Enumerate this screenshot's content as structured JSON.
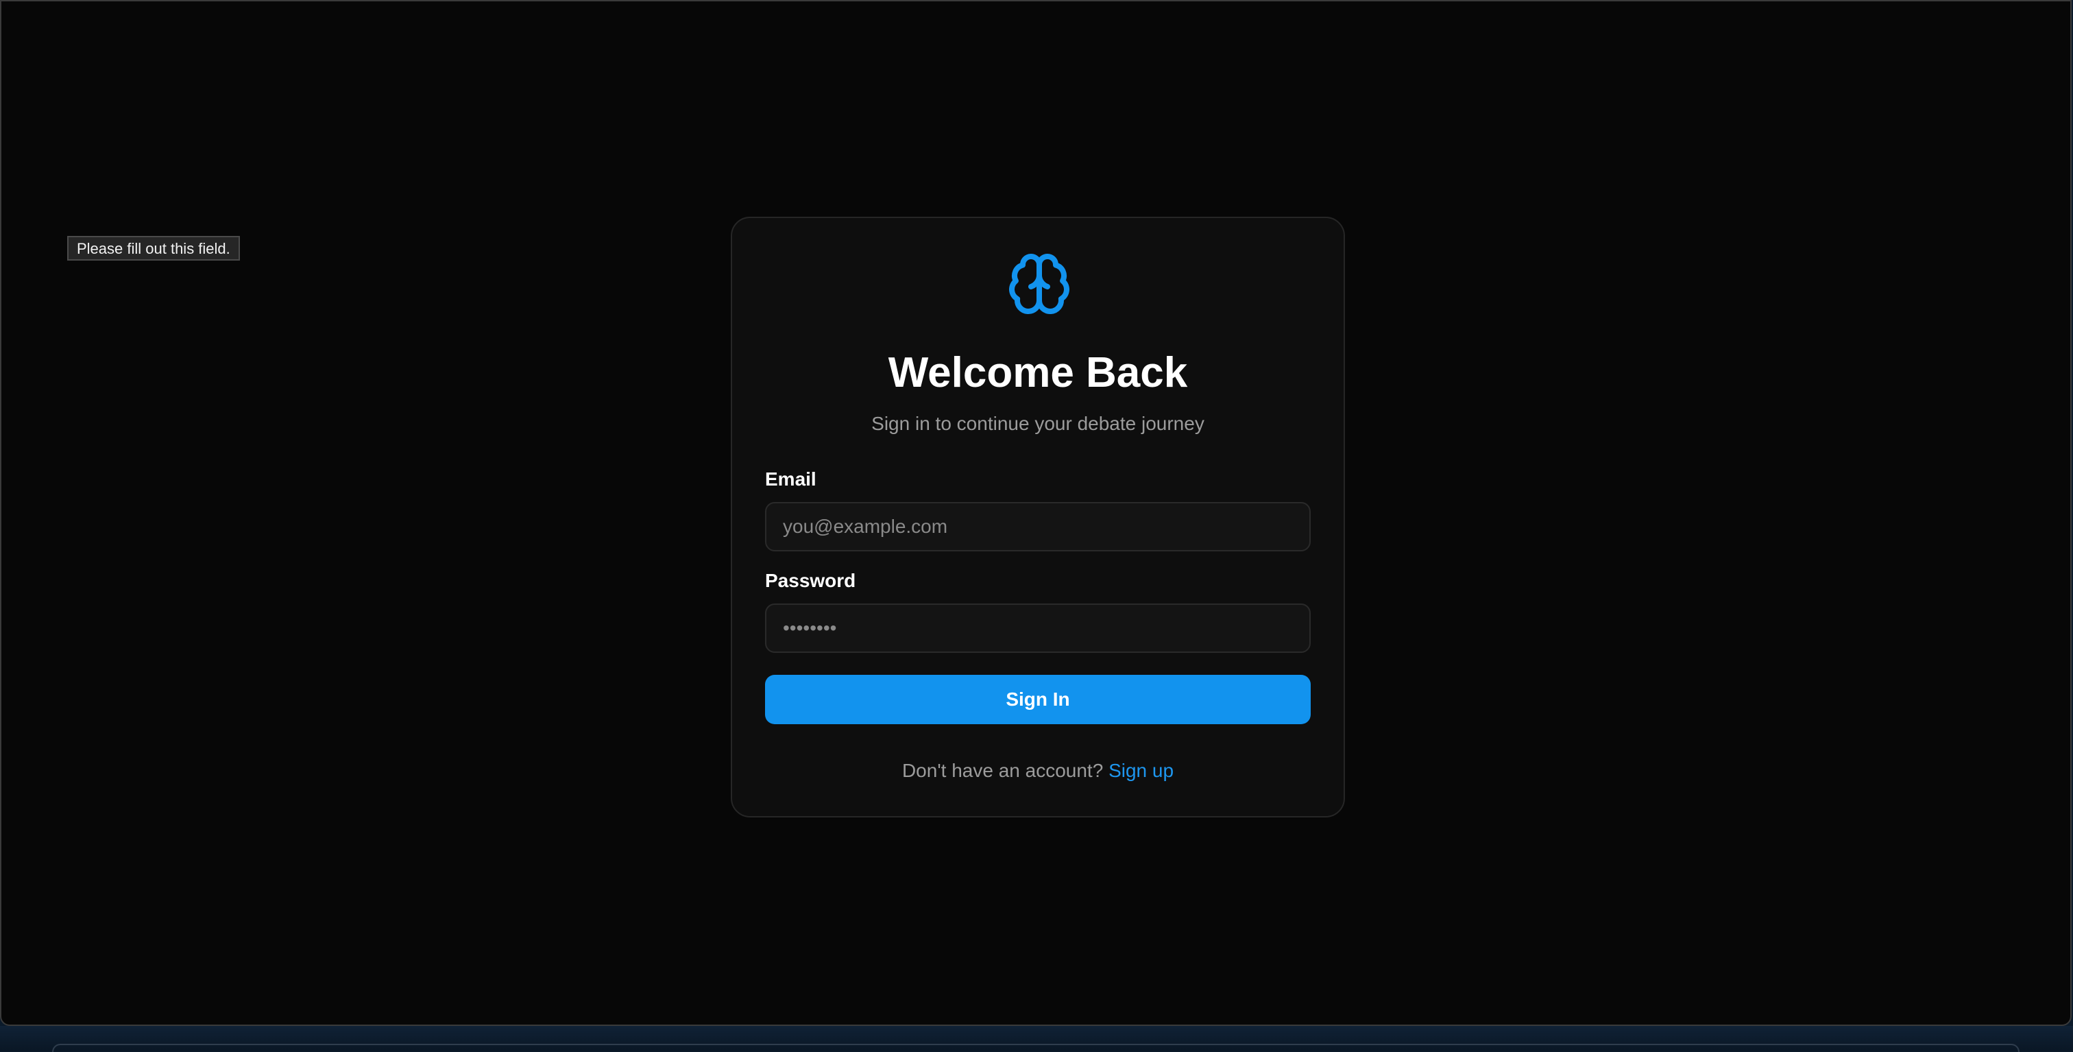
{
  "tooltip": {
    "text": "Please fill out this field."
  },
  "card": {
    "logo_icon": "brain-icon",
    "title": "Welcome Back",
    "subtitle": "Sign in to continue your debate journey"
  },
  "form": {
    "email": {
      "label": "Email",
      "placeholder": "you@example.com",
      "value": ""
    },
    "password": {
      "label": "Password",
      "placeholder": "••••••••",
      "value": ""
    },
    "submit_label": "Sign In"
  },
  "footer": {
    "prompt": "Don't have an account?",
    "signup_label": "Sign up"
  },
  "colors": {
    "background": "#070707",
    "card": "#0e0e0e",
    "accent": "#1293ee",
    "link": "#1e96ee",
    "muted_text": "#9c9c9c"
  }
}
